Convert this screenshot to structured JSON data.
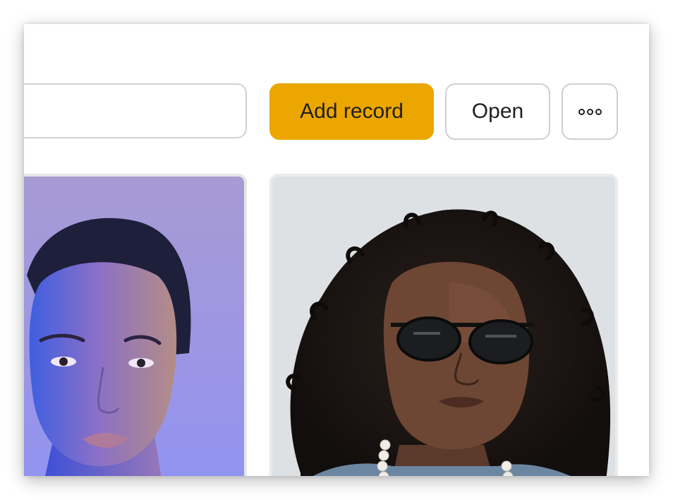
{
  "toolbar": {
    "search_placeholder": "",
    "add_record_label": "Add record",
    "open_label": "Open",
    "more_icon": "more-horizontal-icon"
  },
  "colors": {
    "accent": "#eba600",
    "border": "#cfcfcf",
    "card_border": "#e6e6e6"
  },
  "gallery": {
    "cards": [
      {
        "image": "portrait-woman-blue-lighting"
      },
      {
        "image": "portrait-man-curly-hair-sunglasses"
      }
    ]
  }
}
